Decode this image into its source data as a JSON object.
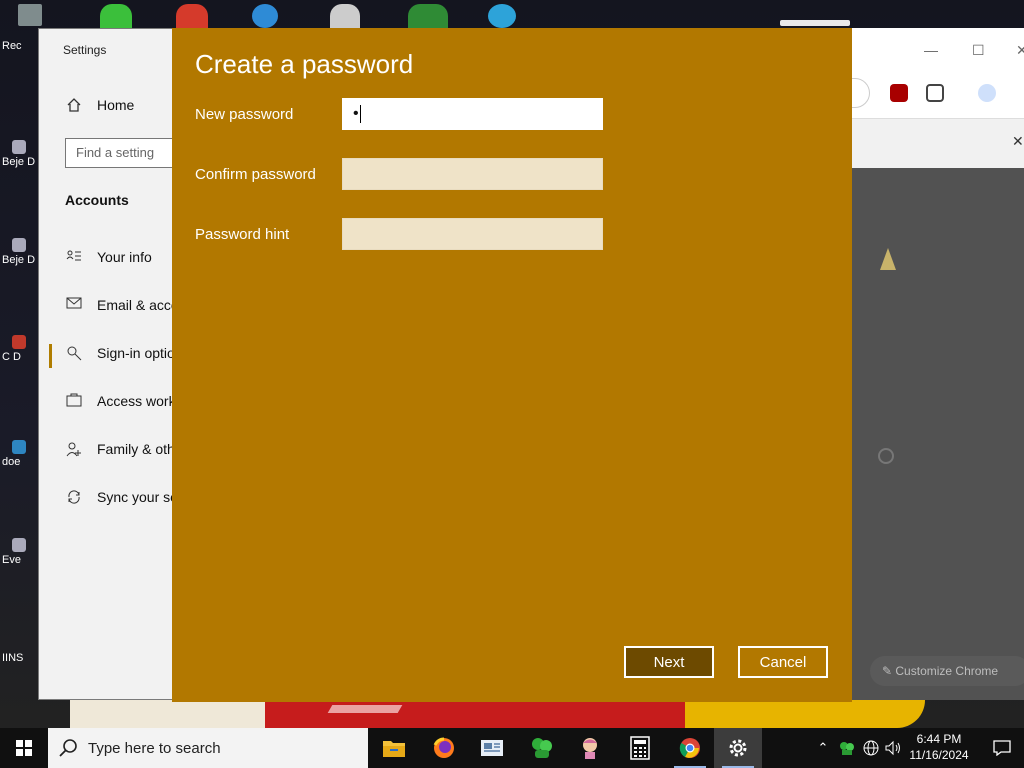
{
  "desktop": {
    "icons": [
      {
        "label": "Rec"
      },
      {
        "label": "Beje D"
      },
      {
        "label": "Beje D"
      },
      {
        "label": "C D"
      },
      {
        "label": "doe"
      },
      {
        "label": "Eve"
      },
      {
        "label": "IINS"
      }
    ]
  },
  "settings": {
    "title": "Settings",
    "home_label": "Home",
    "search_placeholder": "Find a setting",
    "section_title": "Accounts",
    "nav": [
      {
        "label": "Your info",
        "icon": "person-card-icon"
      },
      {
        "label": "Email & acco",
        "icon": "mail-icon"
      },
      {
        "label": "Sign-in optio",
        "icon": "key-icon"
      },
      {
        "label": "Access work",
        "icon": "briefcase-icon"
      },
      {
        "label": "Family & oth",
        "icon": "family-icon"
      },
      {
        "label": "Sync your se",
        "icon": "sync-icon"
      }
    ]
  },
  "chrome": {
    "customize_label": "Customize Chrome"
  },
  "dialog": {
    "title": "Create a password",
    "new_password_label": "New password",
    "new_password_value": "•",
    "confirm_password_label": "Confirm password",
    "confirm_password_value": "",
    "hint_label": "Password hint",
    "hint_value": "",
    "next_label": "Next",
    "cancel_label": "Cancel",
    "accent_color": "#b27800"
  },
  "taskbar": {
    "search_placeholder": "Type here to search",
    "apps": [
      {
        "name": "file-explorer"
      },
      {
        "name": "firefox"
      },
      {
        "name": "news"
      },
      {
        "name": "green-app"
      },
      {
        "name": "character-app"
      },
      {
        "name": "calculator"
      },
      {
        "name": "chrome"
      },
      {
        "name": "settings"
      }
    ],
    "time": "6:44 PM",
    "date": "11/16/2024"
  }
}
